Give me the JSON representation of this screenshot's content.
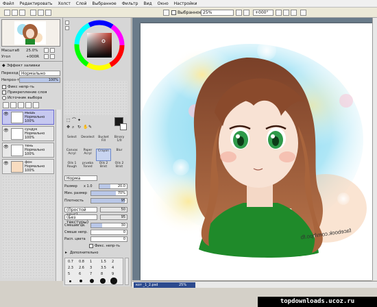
{
  "menu": [
    "Файл",
    "Редактировать",
    "Холст",
    "Слой",
    "Выбранное",
    "Фильтр",
    "Вид",
    "Окно",
    "Настройки"
  ],
  "toolbar": {
    "selected_label": "Выбранное",
    "zoom": "25%",
    "rotation": "+000°"
  },
  "navigator": {
    "zoom_label": "Масштаб",
    "zoom_value": "25.0%",
    "angle_label": "Угол",
    "angle_value": "+000R"
  },
  "fill_effect": {
    "title": "Эффект заливки",
    "blend_label": "Переход",
    "blend_value": "Нормально",
    "opacity_label": "Непроз-ть",
    "opacity_value": "100%"
  },
  "layer_options": [
    "Фикс непр-ть",
    "Прикрепление слоя",
    "Источник выбора"
  ],
  "layers": [
    {
      "name": "мышь",
      "mode": "Нормально",
      "opacity": "100%",
      "selected": true
    },
    {
      "name": "сундук",
      "mode": "Нормально",
      "opacity": "100%",
      "selected": false
    },
    {
      "name": "тень",
      "mode": "Нормально",
      "opacity": "100%",
      "selected": false
    },
    {
      "name": "фон",
      "mode": "Нормально",
      "opacity": "100%",
      "selected": false
    }
  ],
  "tools": [
    {
      "name": "Select",
      "row": 0,
      "col": 0
    },
    {
      "name": "Deselect",
      "row": 0,
      "col": 1
    },
    {
      "name": "Bucket Fill",
      "row": 0,
      "col": 2
    },
    {
      "name": "Binary 1/0",
      "row": 0,
      "col": 3
    },
    {
      "name": "Canvas Acryl",
      "row": 1,
      "col": 0
    },
    {
      "name": "Paper Acryl",
      "row": 1,
      "col": 1
    },
    {
      "name": "Crayon",
      "row": 1,
      "col": 2,
      "selected": true
    },
    {
      "name": "Blur",
      "row": 1,
      "col": 3
    },
    {
      "name": "Oils 1 Rough",
      "row": 2,
      "col": 0
    },
    {
      "name": "prueba Toned",
      "row": 2,
      "col": 1
    },
    {
      "name": "Oils 2 Brist",
      "row": 2,
      "col": 2
    },
    {
      "name": "Oils 2 Brist",
      "row": 2,
      "col": 3
    }
  ],
  "brush": {
    "mode": "Норма",
    "size_label": "Размер",
    "size_mult": "x 1.0",
    "size_value": "20.0",
    "min_size_label": "Мин. размер",
    "min_size_value": "70%",
    "min_size_fill": 0.7,
    "density_label": "Плотность",
    "density_value": "95",
    "density_fill": 0.95,
    "shape_label": "(Простой круг)",
    "shape_value": "50",
    "texture_label": "(Без текстуры)",
    "texture_value": "95",
    "blend_label": "Смешив цв.",
    "blend_value": "30",
    "dilution_label": "Смеше непр.",
    "dilution_value": "0",
    "persistence_label": "Расп. цвета",
    "persistence_value": "0",
    "keep_opacity_label": "Фикс. непр-ть",
    "advanced_label": "Дополнительно"
  },
  "brush_sizes": [
    [
      "0.7",
      "0.8",
      "1",
      "1.5",
      "2"
    ],
    [
      "2.3",
      "2.6",
      "3",
      "3.5",
      "4"
    ],
    [
      "5",
      "6",
      "7",
      "8",
      "9"
    ]
  ],
  "tab": {
    "name": "кот _1_2.psd",
    "zoom": "25%"
  },
  "watermark": "topdownloads.ucoz.ru",
  "canvas_text": "facebook.com/hpo.fb",
  "colors": {
    "accent": "#6a6ad0",
    "canvas_bg": "#6a7b8a",
    "hair": "#9a5a36",
    "sweater": "#1f8a2a",
    "eyes": "#2f9a4a"
  }
}
